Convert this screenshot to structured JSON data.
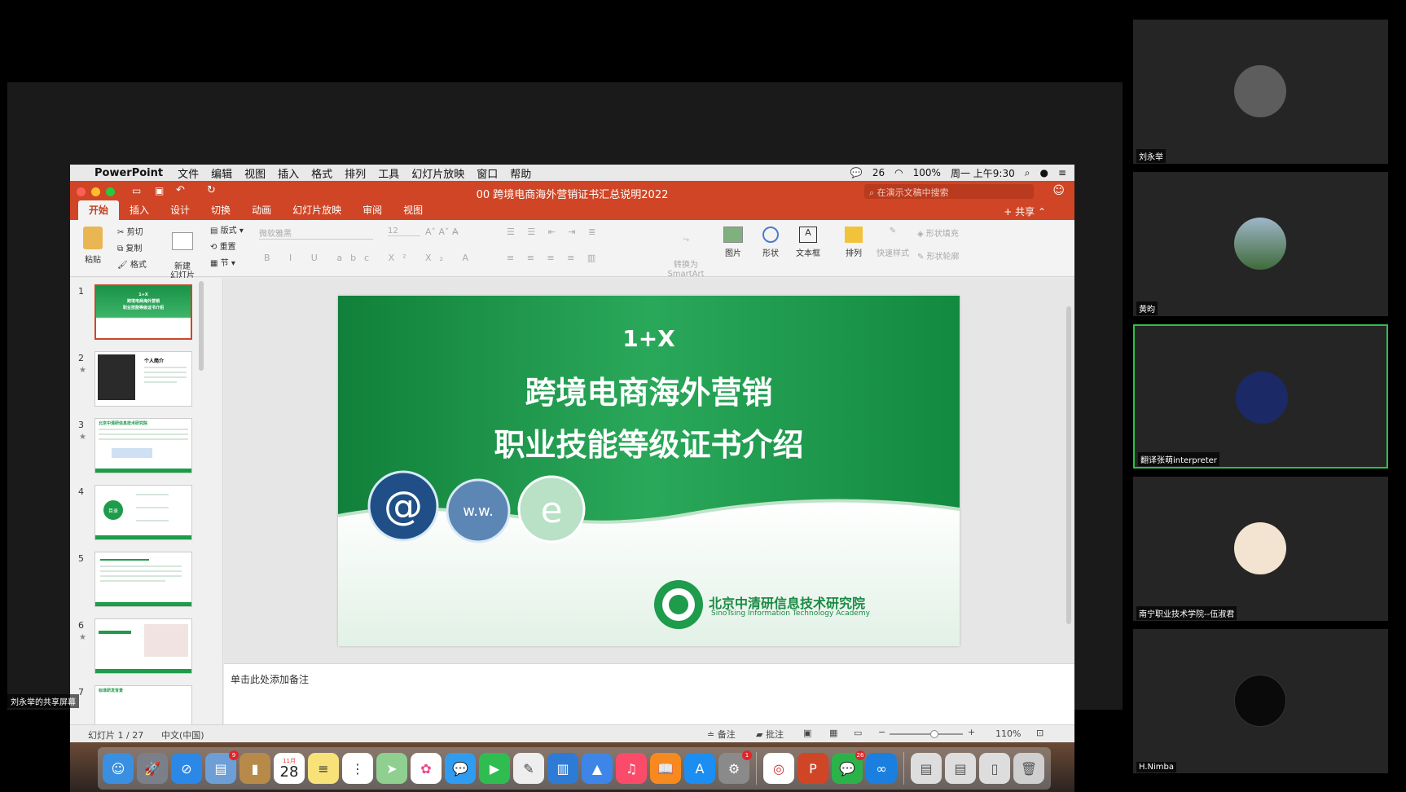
{
  "share": {
    "label": "刘永举的共享屏幕"
  },
  "menubar": {
    "app": "PowerPoint",
    "items": [
      "文件",
      "编辑",
      "视图",
      "插入",
      "格式",
      "排列",
      "工具",
      "幻灯片放映",
      "窗口",
      "帮助"
    ],
    "wechat_count": "26",
    "battery": "100%",
    "clock": "周一 上午9:30"
  },
  "titlebar": {
    "doc_title": "00 跨境电商海外营销证书汇总说明2022",
    "search_placeholder": "在演示文稿中搜索"
  },
  "tabs": [
    "开始",
    "插入",
    "设计",
    "切换",
    "动画",
    "幻灯片放映",
    "审阅",
    "视图"
  ],
  "share_button": "共享",
  "ribbon": {
    "paste": "粘贴",
    "cut": "剪切",
    "copy": "复制",
    "format": "格式",
    "new_slide": "新建\n幻灯片",
    "layout": "版式",
    "reset": "重置",
    "section": "节",
    "font_name": "微软雅黑",
    "font_size": "12",
    "convert_smartart": "转换为\nSmartArt",
    "picture": "图片",
    "shape": "形状",
    "textbox": "文本框",
    "arrange": "排列",
    "quick_styles": "快速样式",
    "shape_fill": "形状填充",
    "shape_outline": "形状轮廓"
  },
  "thumbnails": [
    {
      "num": "1",
      "star": "",
      "title": "1+X\n跨境电商海外营销\n职业技能等级证书介绍"
    },
    {
      "num": "2",
      "star": "★",
      "title": "个人简介"
    },
    {
      "num": "3",
      "star": "★",
      "title": "北京中清研信息技术研究院"
    },
    {
      "num": "4",
      "star": "",
      "title": "目录"
    },
    {
      "num": "5",
      "star": "",
      "title": ""
    },
    {
      "num": "6",
      "star": "★",
      "title": ""
    },
    {
      "num": "7",
      "star": "",
      "title": "标准研发背景"
    }
  ],
  "slide": {
    "line1": "1+X",
    "line2": "跨境电商海外营销",
    "line3": "职业技能等级证书介绍",
    "org_cn": "北京中清研信息技术研究院",
    "org_en": "SinoTsing Information Technology Academy"
  },
  "notes_placeholder": "单击此处添加备注",
  "status": {
    "slide_info": "幻灯片 1 / 27",
    "language": "中文(中国)",
    "notes": "备注",
    "comments": "批注",
    "zoom": "110%"
  },
  "participants": [
    {
      "name": "刘永举",
      "active": false
    },
    {
      "name": "黄昀",
      "active": false
    },
    {
      "name": "翻译张萌interpreter",
      "active": true
    },
    {
      "name": "南宁职业技术学院--伍淑君",
      "active": false
    },
    {
      "name": "H.Nimba",
      "active": false
    }
  ],
  "dock": {
    "calendar_day": "28",
    "calendar_month": "11月"
  },
  "colors": {
    "ppt_accent": "#d04525",
    "slide_green": "#1e9b4b",
    "active_tile": "#2fbf4a"
  }
}
